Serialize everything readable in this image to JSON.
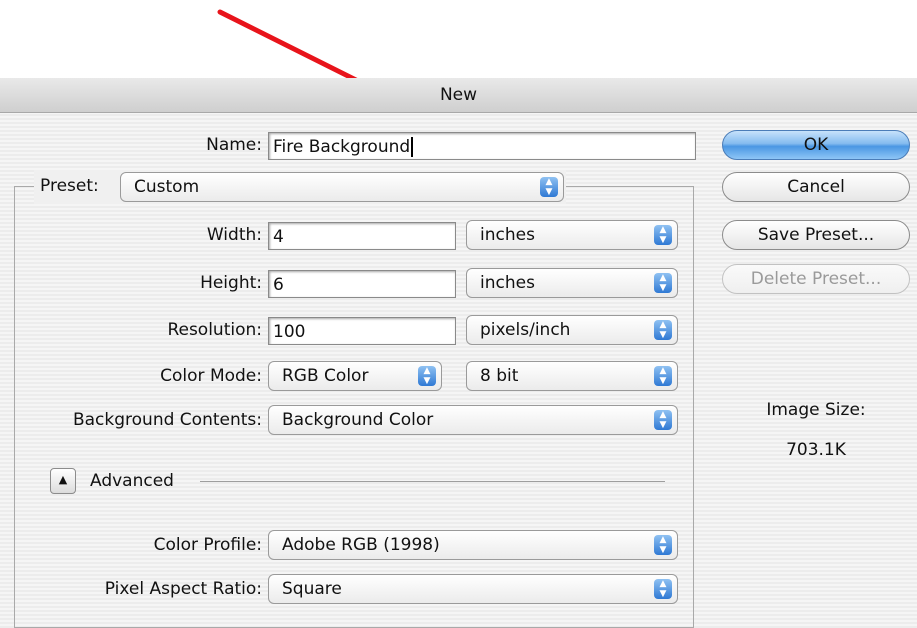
{
  "window": {
    "title": "New"
  },
  "name": {
    "label": "Name:",
    "value": "Fire Background"
  },
  "preset": {
    "label": "Preset:",
    "value": "Custom"
  },
  "width": {
    "label": "Width:",
    "value": "4",
    "unit": "inches"
  },
  "height": {
    "label": "Height:",
    "value": "6",
    "unit": "inches"
  },
  "resolution": {
    "label": "Resolution:",
    "value": "100",
    "unit": "pixels/inch"
  },
  "color_mode": {
    "label": "Color Mode:",
    "value": "RGB Color",
    "depth": "8 bit"
  },
  "background_contents": {
    "label": "Background Contents:",
    "value": "Background Color"
  },
  "advanced": {
    "label": "Advanced"
  },
  "color_profile": {
    "label": "Color Profile:",
    "value": "Adobe RGB (1998)"
  },
  "pixel_aspect_ratio": {
    "label": "Pixel Aspect Ratio:",
    "value": "Square"
  },
  "buttons": {
    "ok": "OK",
    "cancel": "Cancel",
    "save_preset": "Save Preset...",
    "delete_preset": "Delete Preset..."
  },
  "image_size": {
    "label": "Image Size:",
    "value": "703.1K"
  },
  "icons": {
    "stepper": "updown-stepper-icon",
    "disclosure": "triangle-up-icon",
    "annotation": "red-arrow-icon"
  },
  "colors": {
    "annotation_arrow": "#e8141b",
    "default_button": "#4a97e3",
    "stepper": "#2f79d4"
  }
}
